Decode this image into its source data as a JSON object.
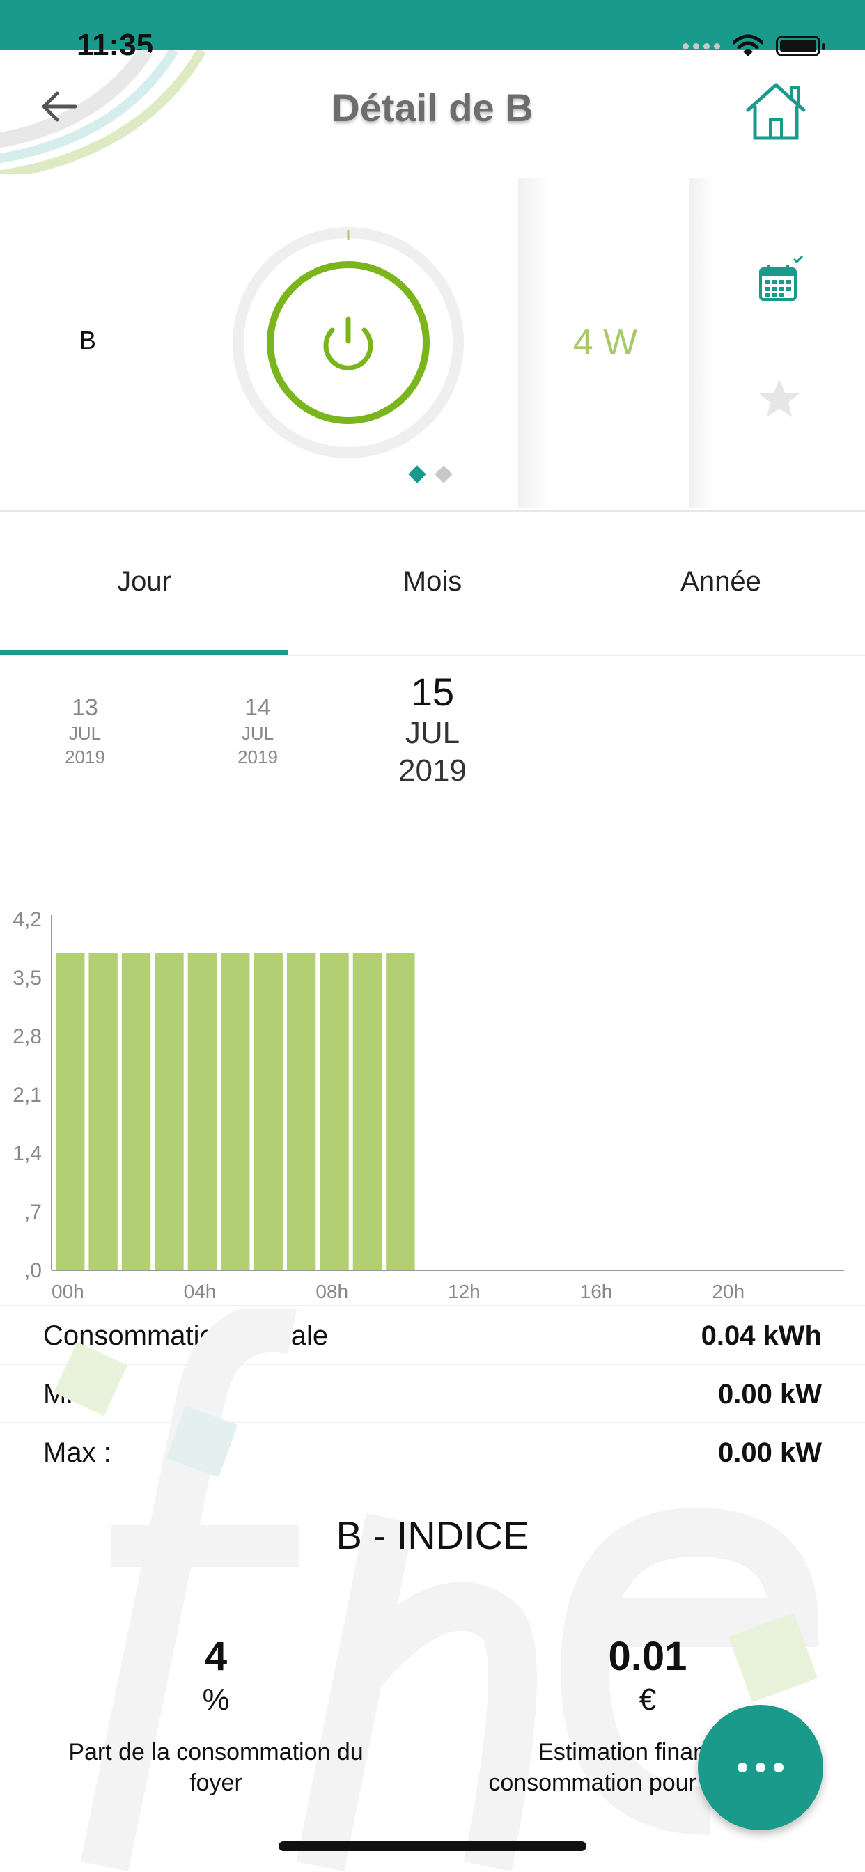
{
  "status_bar": {
    "time": "11:35"
  },
  "header": {
    "title": "Détail de B"
  },
  "device": {
    "name": "B",
    "power": "4 W"
  },
  "tabs": [
    {
      "label": "Jour"
    },
    {
      "label": "Mois"
    },
    {
      "label": "Année"
    }
  ],
  "dates": [
    {
      "day": "13",
      "month": "JUL",
      "year": "2019"
    },
    {
      "day": "14",
      "month": "JUL",
      "year": "2019"
    },
    {
      "day": "15",
      "month": "JUL",
      "year": "2019"
    }
  ],
  "chart_data": {
    "type": "bar",
    "x_tick_labels": [
      "00h",
      "04h",
      "08h",
      "12h",
      "16h",
      "20h"
    ],
    "y_tick_labels": [
      "4,2",
      "3,5",
      "2,8",
      "2,1",
      "1,4",
      ",7",
      ",0"
    ],
    "y_ticks": [
      4.2,
      3.5,
      2.8,
      2.1,
      1.4,
      0.7,
      0.0
    ],
    "ylim": [
      0,
      4.2
    ],
    "x_hours": [
      0,
      1,
      2,
      3,
      4,
      5,
      6,
      7,
      8,
      9,
      10,
      11,
      12,
      13,
      14,
      15,
      16,
      17,
      18,
      19,
      20,
      21,
      22,
      23
    ],
    "values": [
      3.8,
      3.8,
      3.8,
      3.8,
      3.8,
      3.8,
      3.8,
      3.8,
      3.8,
      3.8,
      3.8,
      0,
      0,
      0,
      0,
      0,
      0,
      0,
      0,
      0,
      0,
      0,
      0,
      0
    ],
    "bar_color": "#b3cf74"
  },
  "stats": {
    "global_label": "Consommation globale",
    "global_value": "0.04 kWh",
    "min_label": "Min :",
    "min_value": "0.00 kW",
    "max_label": "Max :",
    "max_value": "0.00 kW"
  },
  "index_section": {
    "title": "B - INDICE",
    "share_value": "4",
    "share_unit": "%",
    "share_label": "Part de la consommation du foyer",
    "cost_value": "0.01",
    "cost_unit": "€",
    "cost_label": "Estimation financière consommation pour la journée"
  },
  "colors": {
    "accent": "#1a9a8a",
    "green": "#7ab51d",
    "light_green": "#a8c96b"
  },
  "icons": [
    "back-arrow-icon",
    "home-icon",
    "power-icon",
    "calendar-check-icon",
    "star-icon",
    "more-icon",
    "wifi-icon",
    "battery-icon"
  ]
}
